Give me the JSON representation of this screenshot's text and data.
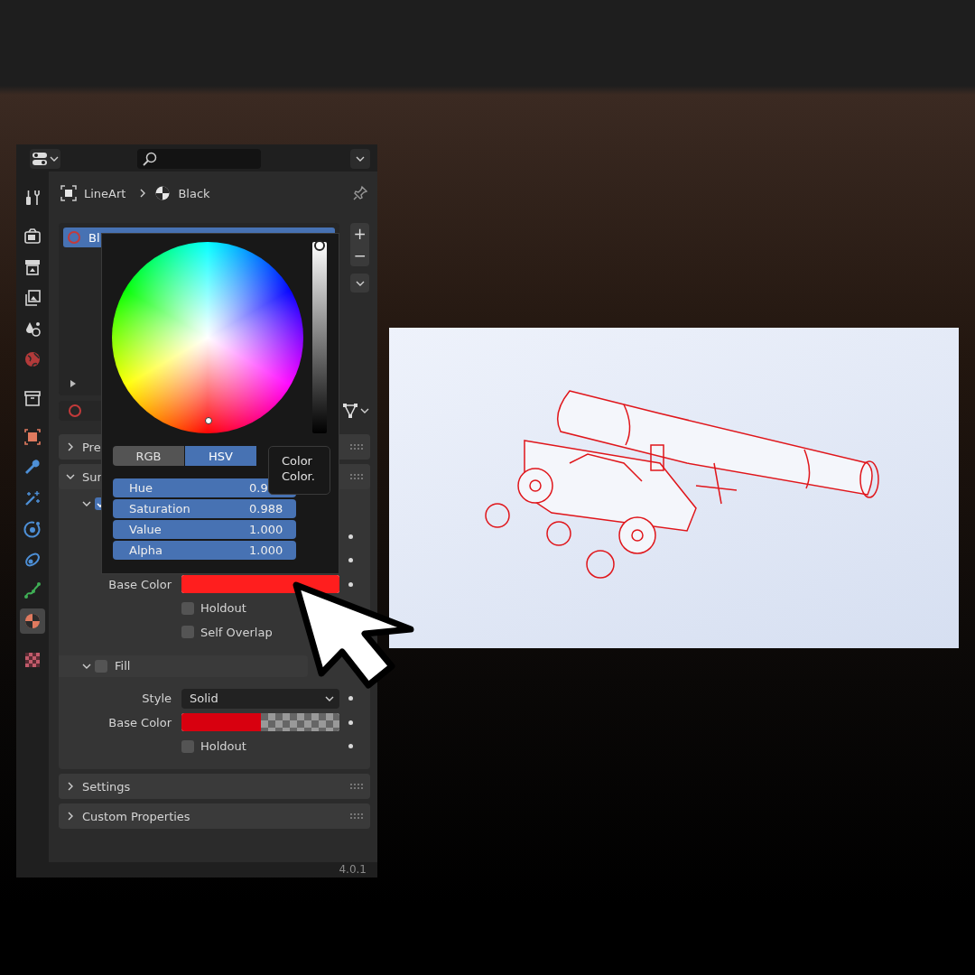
{
  "sidebar_tab_groups": [
    [
      {
        "kind": "tool",
        "selected": false
      }
    ],
    [
      {
        "kind": "render",
        "selected": false
      },
      {
        "kind": "output",
        "selected": false
      },
      {
        "kind": "view_layer",
        "selected": false
      },
      {
        "kind": "scene",
        "selected": false
      },
      {
        "kind": "world",
        "selected": false
      }
    ],
    [
      {
        "kind": "collection",
        "selected": false
      }
    ],
    [
      {
        "kind": "object",
        "selected": false
      },
      {
        "kind": "modifiers",
        "selected": false
      },
      {
        "kind": "effects",
        "selected": false
      },
      {
        "kind": "physics",
        "selected": false
      },
      {
        "kind": "constraints",
        "selected": false
      },
      {
        "kind": "data",
        "selected": false
      },
      {
        "kind": "material",
        "selected": true
      }
    ],
    [
      {
        "kind": "texture",
        "selected": false
      }
    ]
  ],
  "breadcrumb": [
    {
      "kind": "object",
      "label": "LineArt"
    },
    {
      "kind": "material",
      "label": "Black"
    }
  ],
  "material_slots": [
    {
      "name": "Bl",
      "selected": true
    }
  ],
  "slot_buttons": [
    "+",
    "−"
  ],
  "color_picker": {
    "value_slider": {
      "level": 1.0
    },
    "mode_tabs": [
      {
        "label": "RGB",
        "selected": false
      },
      {
        "label": "HSV",
        "selected": true
      }
    ],
    "fields": [
      {
        "label": "Hue",
        "value": "0.9"
      },
      {
        "label": "Saturation",
        "value": "0.988"
      },
      {
        "label": "Value",
        "value": "1.000"
      },
      {
        "label": "Alpha",
        "value": "1.000"
      }
    ],
    "tooltip": [
      "Color",
      "Color."
    ]
  },
  "panels": [
    {
      "title": "Pre",
      "expanded": false
    },
    {
      "title": "Sur",
      "expanded": true,
      "subpanels": [
        {
          "checked": true,
          "expanded": true,
          "rows": [
            {
              "kind": "covered"
            },
            {
              "kind": "covered"
            },
            {
              "kind": "color",
              "label": "Base Color",
              "color": "#ff1e1e",
              "alpha": false
            },
            {
              "kind": "checkbox",
              "label": "Holdout",
              "checked": false
            },
            {
              "kind": "checkbox",
              "label": "Self Overlap",
              "checked": false
            }
          ]
        },
        {
          "title": "Fill",
          "checked": false,
          "expanded": true,
          "rows": [
            {
              "kind": "dropdown",
              "label": "Style",
              "value": "Solid"
            },
            {
              "kind": "color",
              "label": "Base Color",
              "color": "#d8000f",
              "alpha": true
            },
            {
              "kind": "checkbox",
              "label": "Holdout",
              "checked": false
            }
          ]
        }
      ]
    },
    {
      "title": "Settings",
      "expanded": false
    },
    {
      "title": "Custom Properties",
      "expanded": false
    }
  ],
  "version": "4.0.1"
}
